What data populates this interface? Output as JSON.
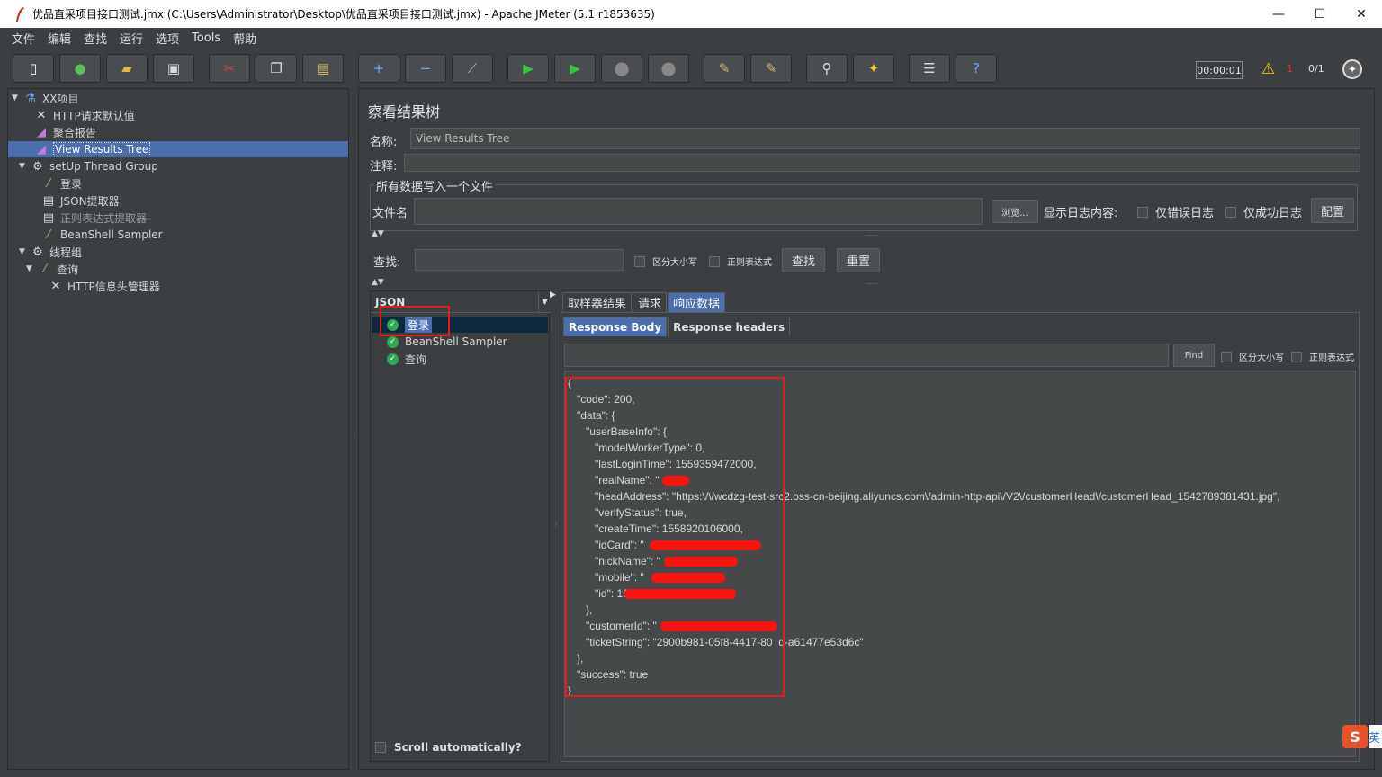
{
  "window": {
    "title": "优品直采项目接口测试.jmx (C:\\Users\\Administrator\\Desktop\\优品直采项目接口测试.jmx) - Apache JMeter (5.1 r1853635)",
    "minimize": "—",
    "maximize": "☐",
    "close": "✕"
  },
  "menu": [
    "文件",
    "编辑",
    "查找",
    "运行",
    "选项",
    "Tools",
    "帮助"
  ],
  "toolbar": {
    "timer": "00:00:01",
    "warning_count": "1",
    "threads": "0/1"
  },
  "tree": [
    {
      "label": "XX项目",
      "icon": "flask-icon",
      "level": 0,
      "twisty": "▼"
    },
    {
      "label": "HTTP请求默认值",
      "icon": "wrench-icon",
      "level": 1,
      "twisty": ""
    },
    {
      "label": "聚合报告",
      "icon": "chart-icon",
      "level": 1,
      "twisty": ""
    },
    {
      "label": "View Results Tree",
      "icon": "chart-icon",
      "level": 1,
      "twisty": "",
      "selected": true
    },
    {
      "label": "setUp Thread Group",
      "icon": "gear-icon",
      "level": 1,
      "twisty": "▼"
    },
    {
      "label": "登录",
      "icon": "pipette-icon",
      "level": 2,
      "twisty": ""
    },
    {
      "label": "JSON提取器",
      "icon": "doc-icon",
      "level": 2,
      "twisty": ""
    },
    {
      "label": "正则表达式提取器",
      "icon": "doc-icon",
      "level": 2,
      "twisty": ""
    },
    {
      "label": "BeanShell Sampler",
      "icon": "pipette-icon",
      "level": 2,
      "twisty": ""
    },
    {
      "label": "线程组",
      "icon": "gear-icon",
      "level": 1,
      "twisty": "▼"
    },
    {
      "label": "查询",
      "icon": "pipette-icon",
      "level": 2,
      "twisty": "▼"
    },
    {
      "label": "HTTP信息头管理器",
      "icon": "wrench-icon",
      "level": 3,
      "twisty": ""
    }
  ],
  "panel": {
    "heading": "察看结果树",
    "name_label": "名称:",
    "name_value": "View Results Tree",
    "comment_label": "注释:",
    "group_title": "所有数据写入一个文件",
    "file_label": "文件名",
    "browse": "浏览...",
    "log_label": "显示日志内容:",
    "errors_only": "仅错误日志",
    "success_only": "仅成功日志",
    "configure": "配置",
    "search_label": "查找:",
    "case_sensitive": "区分大小写",
    "regex": "正则表达式",
    "find_button": "查找",
    "reset_button": "重置"
  },
  "results": {
    "renderer": "JSON",
    "items": [
      "登录",
      "BeanShell Sampler",
      "查询"
    ],
    "scroll_auto": "Scroll automatically?"
  },
  "detail": {
    "tabs": [
      "取样器结果",
      "请求",
      "响应数据"
    ],
    "subtabs": [
      "Response Body",
      "Response headers"
    ],
    "find": "Find",
    "case_sensitive": "区分大小写",
    "regex": "正则表达式",
    "lines": [
      "{",
      "   \"code\": 200,",
      "   \"data\": {",
      "      \"userBaseInfo\": {",
      "         \"modelWorkerType\": 0,",
      "         \"lastLoginTime\": 1559359472000,",
      "         \"realName\": \"",
      "         \"headAddress\": \"https:\\/\\/wcdzg-test-src2.oss-cn-beijing.aliyuncs.com\\/admin-http-api\\/V2\\/customerHead\\/customerHead_1542789381431.jpg\",",
      "         \"verifyStatus\": true,",
      "         \"createTime\": 1558920106000,",
      "         \"idCard\": \"",
      "         \"nickName\": \"",
      "         \"mobile\": \"",
      "         \"id\": 19",
      "      },",
      "      \"customerId\": \"",
      "      \"ticketString\": \"2900b981-05f8-4417-80  d-a61477e53d6c\"",
      "   },",
      "   \"success\": true",
      "}"
    ]
  },
  "ime": {
    "logo": "S",
    "text": "英"
  },
  "colors": {
    "accent": "#4b6eaf",
    "highlight": "#e81a1a",
    "success": "#2fa84f"
  }
}
